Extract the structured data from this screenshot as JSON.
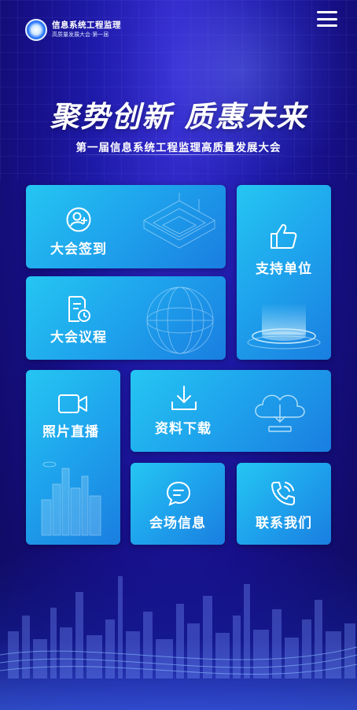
{
  "header": {
    "logo_title": "信息系统工程监理",
    "logo_subtitle": "高质量发展大会·第一届",
    "menu_icon": "hamburger-menu-icon"
  },
  "hero": {
    "slogan": "聚势创新 质惠未来",
    "subtitle": "第一届信息系统工程监理高质量发展大会"
  },
  "tiles": {
    "checkin": {
      "label": "大会签到",
      "icon": "user-add-icon"
    },
    "agenda": {
      "label": "大会议程",
      "icon": "document-clock-icon"
    },
    "support": {
      "label": "支持单位",
      "icon": "thumbs-up-icon"
    },
    "photo": {
      "label": "照片直播",
      "icon": "video-camera-icon"
    },
    "download": {
      "label": "资料下载",
      "icon": "download-icon"
    },
    "venue": {
      "label": "会场信息",
      "icon": "chat-bubble-icon"
    },
    "contact": {
      "label": "联系我们",
      "icon": "phone-icon"
    }
  },
  "colors": {
    "background": "#1e1aa8",
    "tile_blue": "#1a7fe2",
    "tile_cyan": "#25c6f2"
  }
}
